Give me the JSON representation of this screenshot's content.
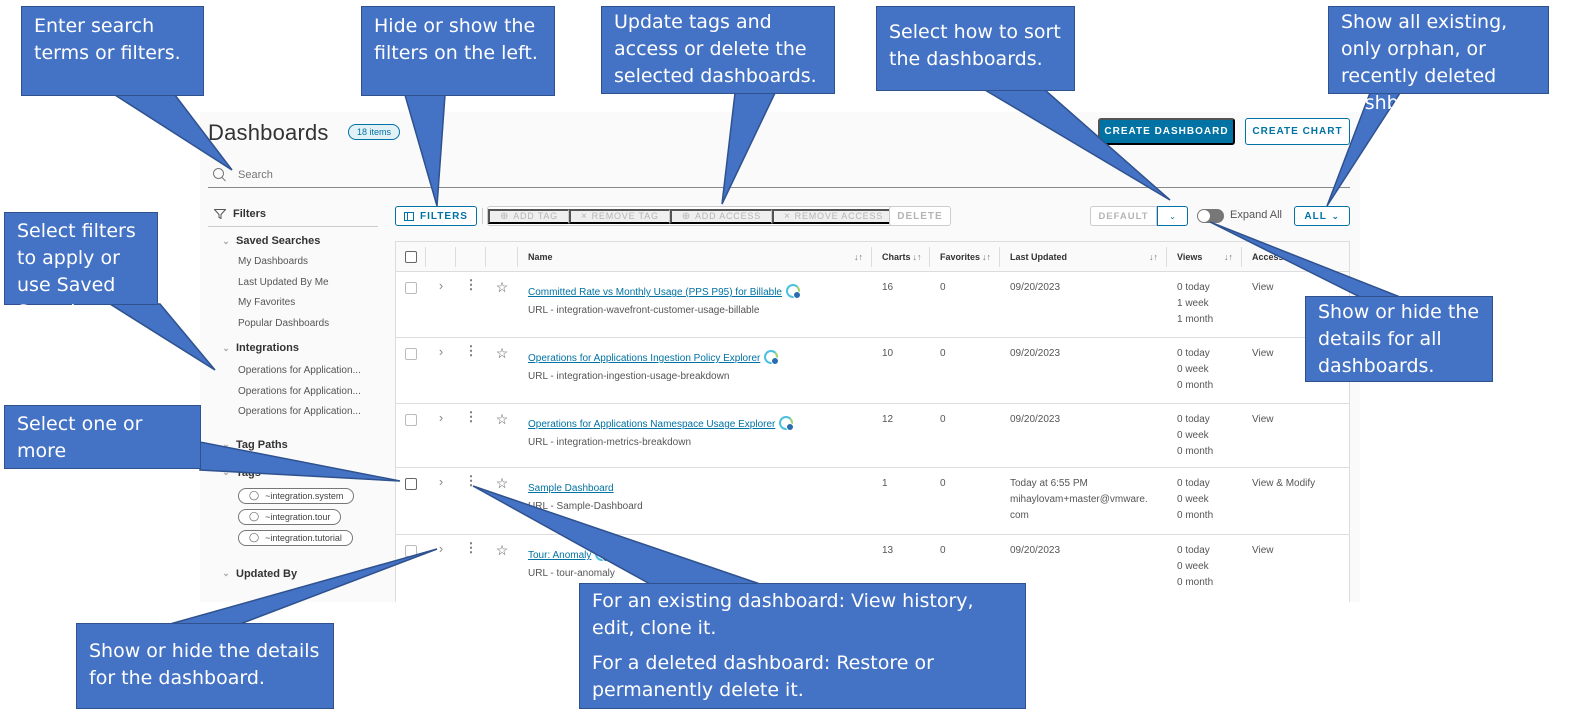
{
  "header": {
    "title": "Dashboards",
    "count_badge": "18 items",
    "create_dashboard": "CREATE DASHBOARD",
    "create_chart": "CREATE CHART"
  },
  "search": {
    "placeholder": "Search",
    "value": ""
  },
  "sidebar": {
    "title": "Filters",
    "saved_searches": {
      "label": "Saved Searches",
      "items": [
        "My Dashboards",
        "Last Updated By Me",
        "My Favorites",
        "Popular Dashboards"
      ]
    },
    "integrations": {
      "label": "Integrations",
      "items": [
        "Operations for Application...",
        "Operations for Application...",
        "Operations for Application..."
      ]
    },
    "tag_paths": {
      "label": "Tag Paths"
    },
    "tags": {
      "label": "Tags",
      "items": [
        "~integration.system",
        "~integration.tour",
        "~integration.tutorial"
      ]
    },
    "updated_by": {
      "label": "Updated By"
    }
  },
  "toolbar": {
    "filters": "FILTERS",
    "add_tag": "ADD TAG",
    "remove_tag": "REMOVE TAG",
    "add_access": "ADD ACCESS",
    "remove_access": "REMOVE ACCESS",
    "delete": "DELETE",
    "sort_selected": "DEFAULT",
    "expand_all_label": "Expand All",
    "expand_all_on": false,
    "scope_selected": "ALL"
  },
  "table": {
    "columns": {
      "name": "Name",
      "charts": "Charts",
      "favorites": "Favorites",
      "last_updated": "Last Updated",
      "views": "Views",
      "access": "Access"
    },
    "rows": [
      {
        "name": "Committed Rate vs Monthly Usage (PPS P95) for Billable",
        "url": "URL - integration-wavefront-customer-usage-billable",
        "integration": true,
        "charts": "16",
        "favorites": "0",
        "updated_line1": "09/20/2023",
        "updated_line2": "",
        "updated_line3": "",
        "views_today": "0 today",
        "views_week": "1 week",
        "views_month": "1 month",
        "access": "View"
      },
      {
        "name": "Operations for Applications Ingestion Policy Explorer",
        "url": "URL - integration-ingestion-usage-breakdown",
        "integration": true,
        "charts": "10",
        "favorites": "0",
        "updated_line1": "09/20/2023",
        "updated_line2": "",
        "updated_line3": "",
        "views_today": "0 today",
        "views_week": "0 week",
        "views_month": "0 month",
        "access": "View"
      },
      {
        "name": "Operations for Applications Namespace Usage Explorer",
        "url": "URL - integration-metrics-breakdown",
        "integration": true,
        "charts": "12",
        "favorites": "0",
        "updated_line1": "09/20/2023",
        "updated_line2": "",
        "updated_line3": "",
        "views_today": "0 today",
        "views_week": "0 week",
        "views_month": "0 month",
        "access": "View"
      },
      {
        "name": "Sample Dashboard",
        "url": "URL - Sample-Dashboard",
        "integration": false,
        "charts": "1",
        "favorites": "0",
        "updated_line1": "Today at 6:55 PM",
        "updated_line2": "mihaylovam+master@vmware.",
        "updated_line3": "com",
        "views_today": "0 today",
        "views_week": "0 week",
        "views_month": "0 month",
        "access": "View & Modify"
      },
      {
        "name": "Tour: Anomaly",
        "url": "URL - tour-anomaly",
        "integration": true,
        "charts": "13",
        "favorites": "0",
        "updated_line1": "09/20/2023",
        "updated_line2": "",
        "updated_line3": "",
        "views_today": "0 today",
        "views_week": "0 week",
        "views_month": "0 month",
        "access": "View"
      }
    ]
  },
  "callouts": {
    "search": "Enter search terms or filters.",
    "filters_toggle": "Hide or show  the filters on the left.",
    "bulk_actions": "Update tags and access or delete the selected dashboards.",
    "sort": "Select how to sort the dashboards.",
    "scope": "Show all existing, only orphan, or recently deleted dashboards.",
    "sidebar": "Select filters to apply or use Saved Searches.",
    "select": "Select one or more dashboards.",
    "expand_all": "Show or hide the details for all dashboards.",
    "expand_row": "Show or hide the details for the dashboard.",
    "menu_existing": "For an existing dashboard: View history, edit, clone it.",
    "menu_deleted": "For a deleted dashboard: Restore or permanently delete it."
  }
}
